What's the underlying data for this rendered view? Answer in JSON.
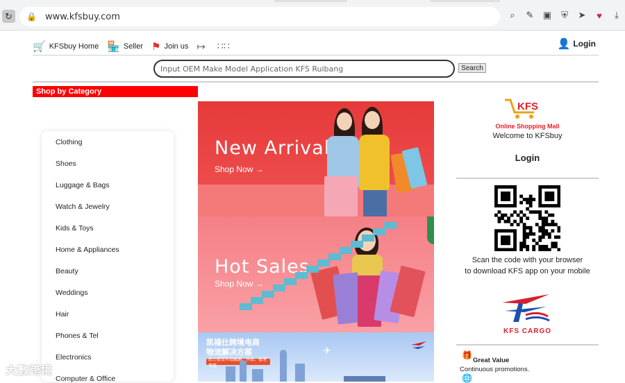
{
  "browser": {
    "url": "www.kfsbuy.com",
    "icons": [
      "reload-icon",
      "lock-icon",
      "search-icon",
      "edit-icon",
      "camera-icon",
      "shield-icon",
      "send-icon",
      "heart-icon",
      "download-icon"
    ]
  },
  "nav": {
    "home": "KFSbuy Home",
    "seller": "Seller",
    "join": "Join us",
    "login": "Login"
  },
  "search": {
    "placeholder": "Input OEM Make Model Application KFS Ruibang",
    "button": "Search"
  },
  "categories": {
    "header": "Shop by Category",
    "items": [
      "Clothing",
      "Shoes",
      "Luggage & Bags",
      "Watch & Jewelry",
      "Kids & Toys",
      "Home & Appliances",
      "Beauty",
      "Weddings",
      "Hair",
      "Phones & Tel",
      "Electronics",
      "Computer & Office"
    ]
  },
  "banners": [
    {
      "title": "New Arrivals",
      "cta": "Shop Now →"
    },
    {
      "title": "Hot Sales",
      "cta": "Shop Now →"
    },
    {
      "line1": "凯福仕跨境电商",
      "line2": "物流解决方案",
      "tag": "助力提货年站融通、华南、香港等整"
    }
  ],
  "sidebar": {
    "logo_text": "KFS",
    "mall": "Online Shopping Mall",
    "welcome": "Welcome to KFSbuy",
    "login": "Login",
    "scan_line1": "Scan the code with your browser",
    "scan_line2": "to download KFS app on your mobile",
    "cargo": "KFS CARGO",
    "great_value_title": "Great Value",
    "great_value_desc": "Continuous promotions."
  },
  "watermark": "大數跨境",
  "colors": {
    "brand_red": "#ff0000",
    "accent": "#e4202b"
  }
}
